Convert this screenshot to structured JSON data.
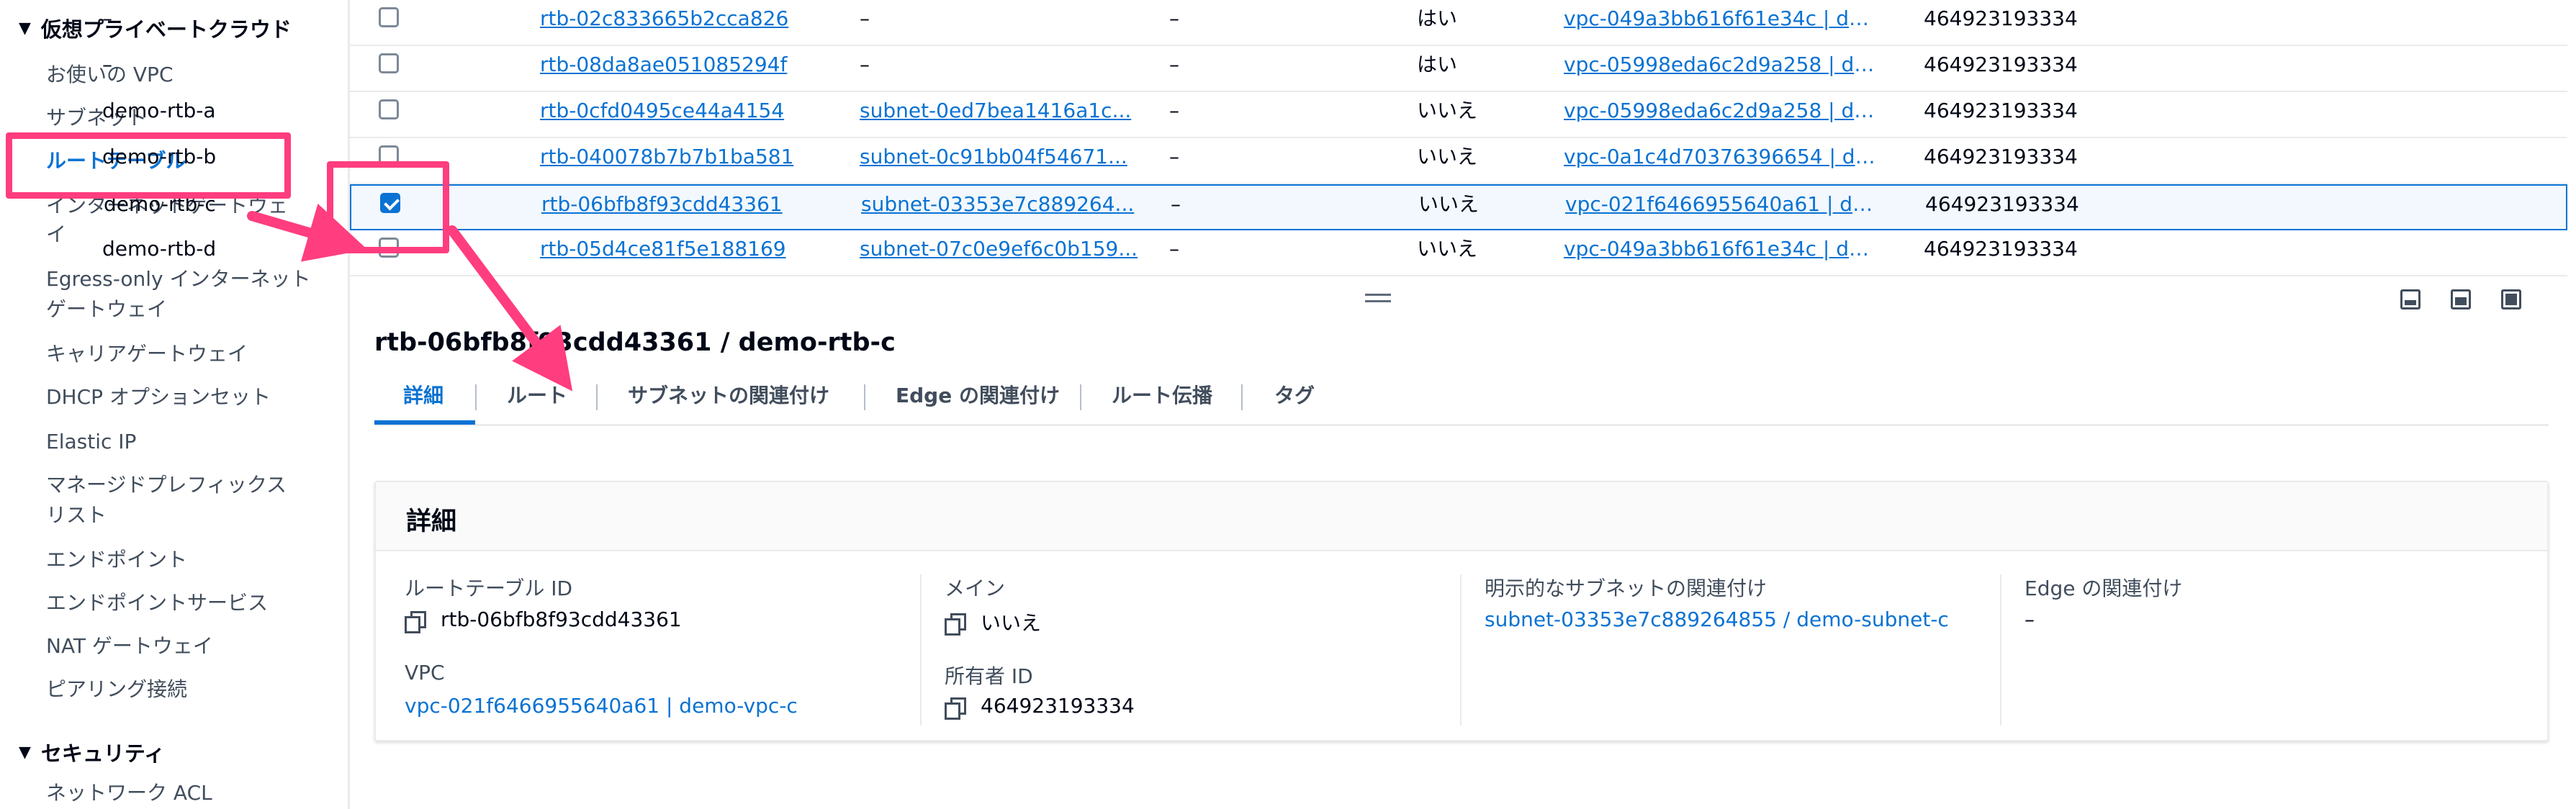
{
  "sidebar": {
    "section_vpc": "仮想プライベートクラウド",
    "items": [
      "お使いの VPC",
      "サブネット",
      "ルートテーブル",
      "インターネットゲートウェ",
      "イ",
      "Egress-only インターネット",
      "ゲートウェイ",
      "キャリアゲートウェイ",
      "DHCP オプションセット",
      "Elastic IP",
      "マネージドプレフィックス",
      "リスト",
      "エンドポイント",
      "エンドポイントサービス",
      "NAT ゲートウェイ",
      "ピアリング接続"
    ],
    "section_security": "セキュリティ",
    "security_items": [
      "ネットワーク ACL"
    ],
    "active_item": "ルートテーブル"
  },
  "table": {
    "rows": [
      {
        "name": "–",
        "id": "rtb-02c833665b2cca826",
        "subnet": "–",
        "edge": "–",
        "main": "はい",
        "vpc": "vpc-049a3bb616f61e34c | dem...",
        "owner": "464923193334",
        "checked": false
      },
      {
        "name": "–",
        "id": "rtb-08da8ae051085294f",
        "subnet": "–",
        "edge": "–",
        "main": "はい",
        "vpc": "vpc-05998eda6c2d9a258 | dem...",
        "owner": "464923193334",
        "checked": false
      },
      {
        "name": "demo-rtb-a",
        "id": "rtb-0cfd0495ce44a4154",
        "subnet": "subnet-0ed7bea1416a1c...",
        "edge": "–",
        "main": "いいえ",
        "vpc": "vpc-05998eda6c2d9a258 | dem...",
        "owner": "464923193334",
        "checked": false
      },
      {
        "name": "demo-rtb-b",
        "id": "rtb-040078b7b7b1ba581",
        "subnet": "subnet-0c91bb04f54671...",
        "edge": "–",
        "main": "いいえ",
        "vpc": "vpc-0a1c4d70376396654 | dem...",
        "owner": "464923193334",
        "checked": false
      },
      {
        "name": "demo-rtb-c",
        "id": "rtb-06bfb8f93cdd43361",
        "subnet": "subnet-03353e7c889264...",
        "edge": "–",
        "main": "いいえ",
        "vpc": "vpc-021f6466955640a61 | dem...",
        "owner": "464923193334",
        "checked": true
      },
      {
        "name": "demo-rtb-d",
        "id": "rtb-05d4ce81f5e188169",
        "subnet": "subnet-07c0e9ef6c0b159...",
        "edge": "–",
        "main": "いいえ",
        "vpc": "vpc-049a3bb616f61e34c | dem...",
        "owner": "464923193334",
        "checked": false
      }
    ]
  },
  "detail": {
    "title": "rtb-06bfb8f93cdd43361 / demo-rtb-c",
    "tabs": [
      "詳細",
      "ルート",
      "サブネットの関連付け",
      "Edge の関連付け",
      "ルート伝播",
      "タグ"
    ],
    "card_title": "詳細",
    "fields": {
      "rtb_id_label": "ルートテーブル ID",
      "rtb_id_value": "rtb-06bfb8f93cdd43361",
      "vpc_label": "VPC",
      "vpc_value": "vpc-021f6466955640a61 | demo-vpc-c",
      "main_label": "メイン",
      "main_value": "いいえ",
      "owner_label": "所有者 ID",
      "owner_value": "464923193334",
      "subnet_assoc_label": "明示的なサブネットの関連付け",
      "subnet_assoc_value": "subnet-03353e7c889264855 / demo-subnet-c",
      "edge_assoc_label": "Edge の関連付け",
      "edge_assoc_value": "–"
    }
  },
  "colors": {
    "link": "#0972d3",
    "annotation": "#ff3d7f",
    "selected_row_bg": "#f2f8fd"
  }
}
